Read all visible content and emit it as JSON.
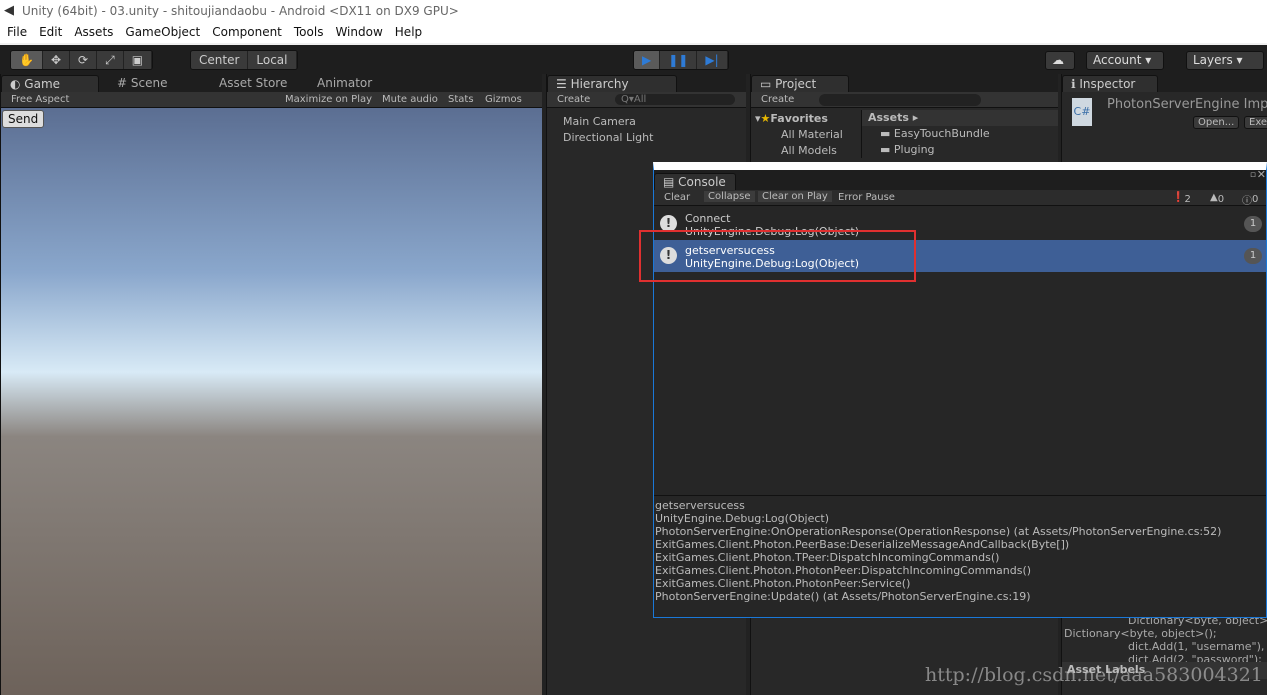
{
  "window": {
    "title": "Unity (64bit) - 03.unity - shitoujiandaobu - Android <DX11 on DX9 GPU>"
  },
  "menu": [
    "File",
    "Edit",
    "Assets",
    "GameObject",
    "Component",
    "Tools",
    "Window",
    "Help"
  ],
  "toolbar": {
    "pivot": "Center",
    "space": "Local",
    "account": "Account",
    "layers": "Layers"
  },
  "game": {
    "tabs": [
      "Game",
      "Scene",
      "Asset Store",
      "Animator"
    ],
    "aspect": "Free Aspect",
    "maximize": "Maximize on Play",
    "mute": "Mute audio",
    "stats": "Stats",
    "gizmos": "Gizmos",
    "send_button": "Send"
  },
  "hierarchy": {
    "tab": "Hierarchy",
    "create": "Create",
    "search_placeholder": "Q▾All",
    "items": [
      "Main Camera",
      "Directional Light"
    ]
  },
  "project": {
    "tab": "Project",
    "create": "Create",
    "favorites": "Favorites",
    "fav_items": [
      "All Material",
      "All Models"
    ],
    "assets": "Assets",
    "folders": [
      "EasyTouchBundle",
      "Pluging"
    ]
  },
  "inspector": {
    "tab": "Inspector",
    "name": "PhotonServerEngine Impo",
    "open": "Open...",
    "exec": "Exe",
    "code": [
      "Dictionary<byte, object>",
      "Dictionary<byte, object>();",
      "dict.Add(1, \"username\"),",
      "dict.Add(2, \"password\");"
    ],
    "asset_labels": "Asset Labels"
  },
  "console": {
    "tab": "Console",
    "buttons": [
      "Clear",
      "Collapse",
      "Clear on Play",
      "Error Pause"
    ],
    "counts": {
      "log": "2",
      "warn": "0",
      "error": "0"
    },
    "entries": [
      {
        "msg": "Connect",
        "src": "UnityEngine.Debug:Log(Object)",
        "count": "1",
        "selected": false
      },
      {
        "msg": "getserversucess",
        "src": "UnityEngine.Debug:Log(Object)",
        "count": "1",
        "selected": true
      }
    ],
    "detail": [
      "getserversucess",
      "UnityEngine.Debug:Log(Object)",
      "PhotonServerEngine:OnOperationResponse(OperationResponse) (at Assets/PhotonServerEngine.cs:52)",
      "ExitGames.Client.Photon.PeerBase:DeserializeMessageAndCallback(Byte[])",
      "ExitGames.Client.Photon.TPeer:DispatchIncomingCommands()",
      "ExitGames.Client.Photon.PhotonPeer:DispatchIncomingCommands()",
      "ExitGames.Client.Photon.PhotonPeer:Service()",
      "PhotonServerEngine:Update() (at Assets/PhotonServerEngine.cs:19)"
    ]
  },
  "watermark": "http://blog.csdn.net/aaa583004321",
  "colors": {
    "highlight": "#e03030",
    "selected": "#3e5f96",
    "play": "#2e7bd6"
  }
}
